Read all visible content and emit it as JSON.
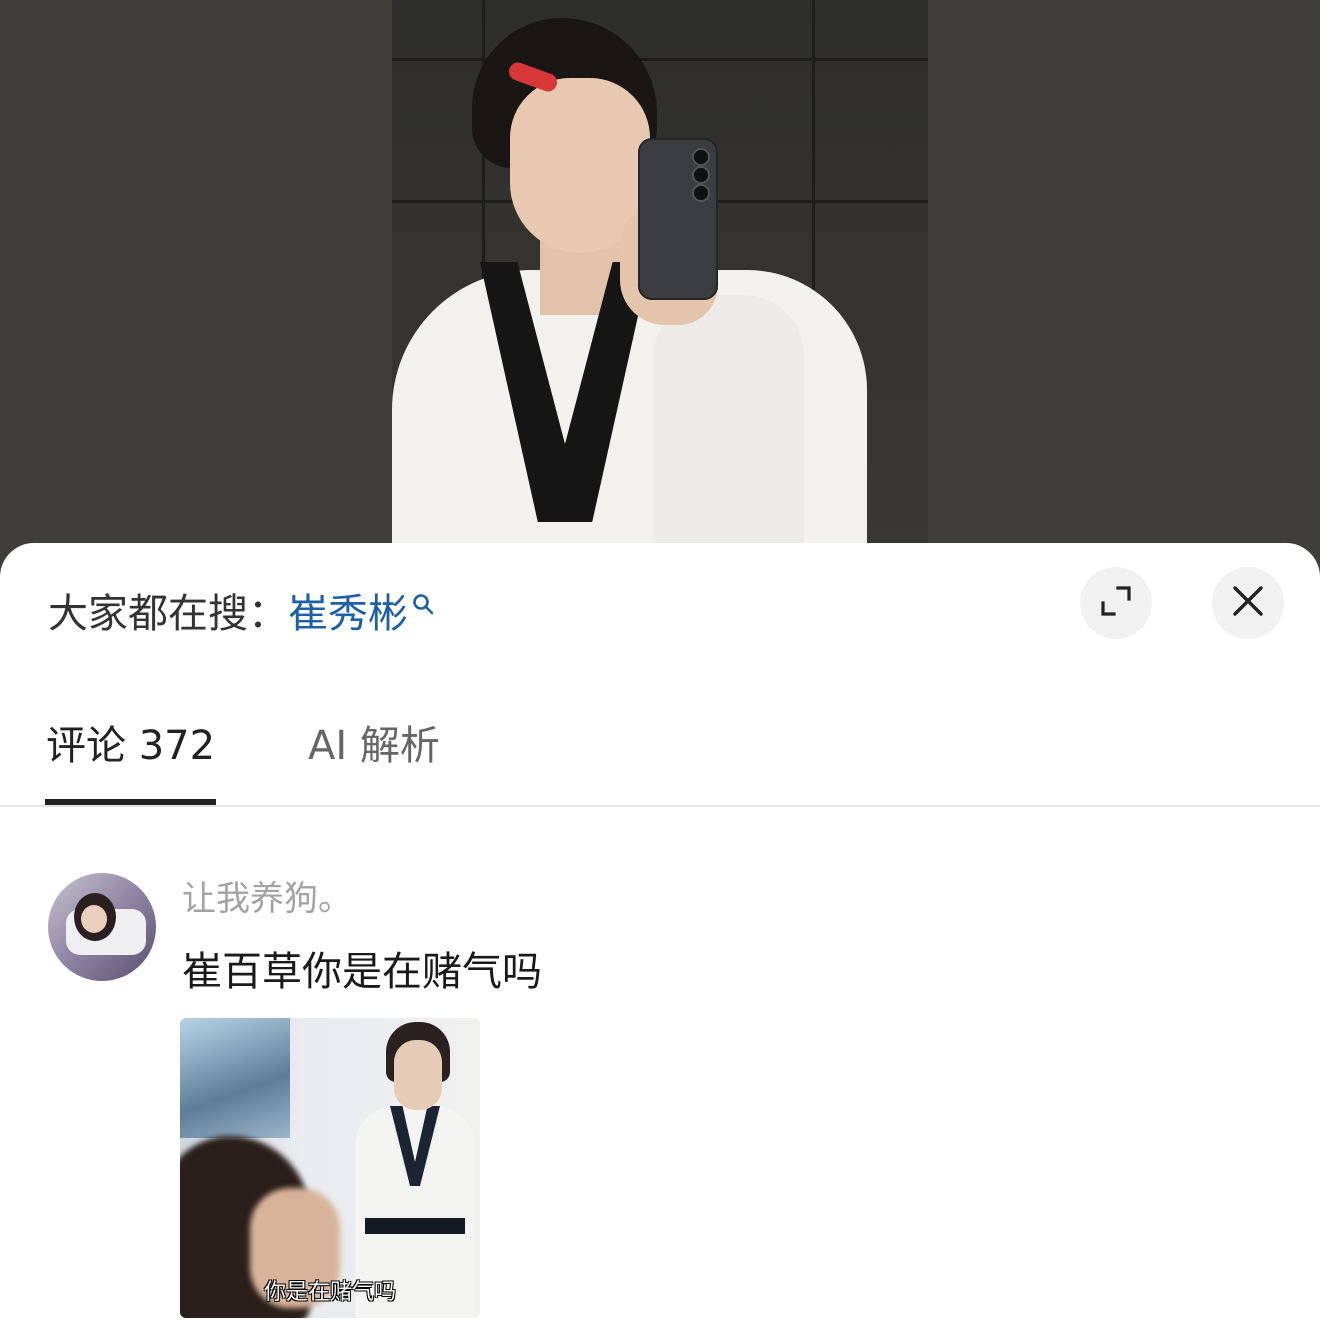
{
  "search_bar": {
    "prefix": "大家都在搜：",
    "term": "崔秀彬",
    "icon": "search-icon"
  },
  "header_buttons": {
    "expand_icon": "expand-icon",
    "close_icon": "close-icon"
  },
  "tabs": [
    {
      "label": "评论 372",
      "active": true
    },
    {
      "label": "AI 解析",
      "active": false
    }
  ],
  "comments": [
    {
      "username": "让我养狗。",
      "text": "崔百草你是在赌气吗",
      "image_caption": "你是在赌气吗"
    }
  ],
  "colors": {
    "link": "#1d5fa8",
    "backdrop": "#3f3e3b",
    "sheet": "#ffffff",
    "muted_text": "#a3a3a3"
  }
}
